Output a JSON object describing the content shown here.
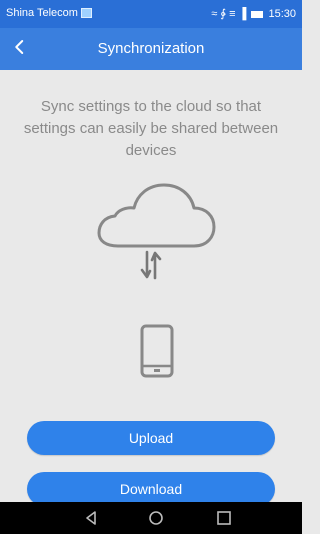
{
  "status_bar": {
    "carrier": "Shina Telecom",
    "time": "15:30",
    "indicators": "≈ ∳ ≡ ▐"
  },
  "app_bar": {
    "title": "Synchronization",
    "back_icon": "chevron-left"
  },
  "main": {
    "description": "Sync settings to the cloud so that settings can easily be shared between devices",
    "illustration_icons": [
      "cloud-icon",
      "sync-arrows-icon",
      "phone-icon"
    ]
  },
  "buttons": {
    "upload_label": "Upload",
    "download_label": "Download"
  },
  "nav_bar": {
    "icons": [
      "back-triangle",
      "home-circle",
      "recents-square"
    ]
  },
  "colors": {
    "accent": "#2f82ea",
    "header": "#3a7fde",
    "status_bar": "#2a6fd6",
    "background": "#e9e9e9",
    "text_muted": "#8a8a8a"
  }
}
